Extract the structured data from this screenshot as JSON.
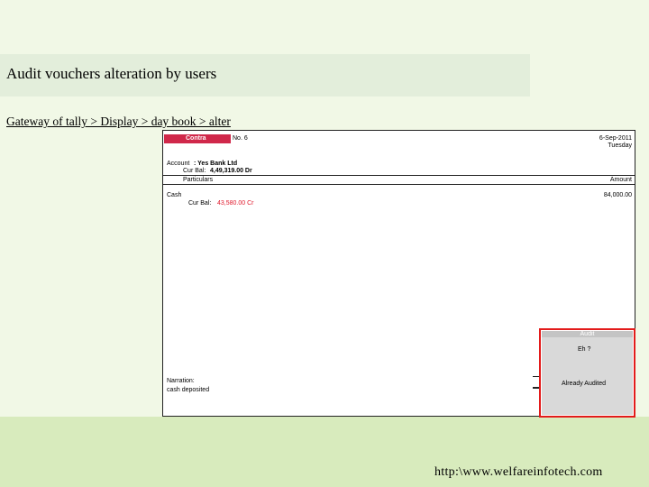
{
  "slide": {
    "title": "Audit vouchers alteration by users",
    "path": "Gateway of tally > Display > day book > alter",
    "footer_url": "http:\\www.welfareinfotech.com"
  },
  "voucher": {
    "type_badge": "Contra",
    "number": "No. 6",
    "date": "6-Sep-2011",
    "day": "Tuesday",
    "account_label": "Account",
    "account_value": ":  Yes Bank Ltd",
    "account_bal_label": "Cur Bal:",
    "account_bal_value": "4,49,319.00 Dr",
    "col_particulars": "Particulars",
    "col_amount": "Amount",
    "ledger_name": "Cash",
    "ledger_amount": "84,000.00",
    "ledger_bal_label": "Cur Bal:",
    "ledger_bal_value": "43,580.00 Cr",
    "narration_label": "Narration:",
    "narration_value": "cash deposited"
  },
  "dialog": {
    "header": "Audit",
    "line1": "Eh ?",
    "line2": "Already Audited"
  },
  "colors": {
    "badge": "#d0284a",
    "highlight_border": "#e31b1b",
    "balance_red": "#e0192c"
  }
}
